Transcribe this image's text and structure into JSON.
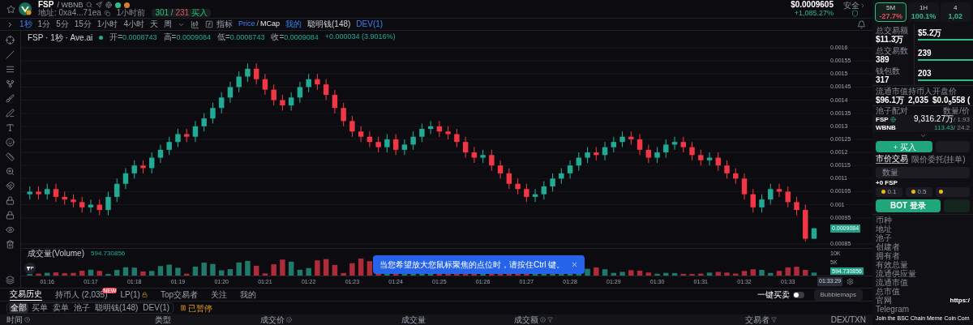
{
  "header": {
    "symbol": "FSP",
    "pair": "/ WBNB",
    "address": "地址: 0xa4...71ea",
    "age": "1小时前",
    "tx_counts": {
      "buys": "301",
      "separator": "/",
      "sells": "231",
      "label": "买入"
    },
    "price": "$0.0009605",
    "change": "+1,085.27%",
    "safety": "安全"
  },
  "toolbar": {
    "intervals": [
      {
        "label": "1秒",
        "selected": true
      },
      {
        "label": "1分",
        "selected": false
      },
      {
        "label": "5分",
        "selected": false
      },
      {
        "label": "15分",
        "selected": false
      },
      {
        "label": "1小时",
        "selected": false
      },
      {
        "label": "4小时",
        "selected": false
      },
      {
        "label": "天",
        "selected": false
      },
      {
        "label": "周",
        "selected": false
      }
    ],
    "indicators": "指标",
    "price_mcap": [
      {
        "label": "Price",
        "selected": true
      },
      {
        "label": "MCap",
        "selected": false
      }
    ],
    "price_mcap_separator": "/",
    "markers": [
      {
        "label": "我的",
        "on": true
      },
      {
        "label": "聪明钱(148)",
        "on": false
      },
      {
        "label": "DEV(1)",
        "on": true
      }
    ]
  },
  "legend": {
    "title": "FSP · 1秒 · Ave.ai",
    "ohlc": [
      {
        "label": "开=",
        "value": "0.0008743"
      },
      {
        "label": "高=",
        "value": "0.0009084"
      },
      {
        "label": "低=",
        "value": "0.0008743"
      },
      {
        "label": "收=",
        "value": "0.0009084"
      }
    ],
    "change": "+0.000034 (3.9016%)"
  },
  "price_chart": {
    "chart_data": {
      "type": "candlestick",
      "grid": true,
      "xlim": [
        75.4,
        94.94
      ],
      "ylim": [
        0.00085,
        0.0016
      ],
      "x": [
        75.6,
        75.8,
        76,
        76.2,
        76.4,
        76.6,
        76.8,
        77,
        77.2,
        77.4,
        77.6,
        77.8,
        78,
        78.2,
        78.4,
        78.6,
        78.8,
        79,
        79.2,
        79.4,
        79.6,
        79.8,
        80,
        80.2,
        80.4,
        80.6,
        80.8,
        81,
        81.2,
        81.4,
        81.6,
        81.8,
        82,
        82.2,
        82.4,
        82.6,
        82.8,
        83,
        83.2,
        83.4,
        83.6,
        83.8,
        84,
        84.2,
        84.4,
        84.6,
        84.8,
        85,
        85.2,
        85.4,
        85.6,
        85.8,
        86,
        86.2,
        86.4,
        86.6,
        86.8,
        87,
        87.2,
        87.4,
        87.6,
        87.8,
        88,
        88.2,
        88.4,
        88.6,
        88.8,
        89,
        89.2,
        89.4,
        89.6,
        89.8,
        90,
        90.2,
        90.4,
        90.6,
        90.8,
        91,
        91.2,
        91.4,
        91.6,
        91.8,
        92,
        92.2,
        92.4,
        92.6,
        92.8,
        93,
        93.2,
        93.4,
        93.6
      ],
      "ohlc": [
        [
          0.00104,
          0.00107,
          0.00102,
          0.00105
        ],
        [
          0.00105,
          0.00107,
          0.00102,
          0.00104
        ],
        [
          0.00104,
          0.00108,
          0.00102,
          0.00106
        ],
        [
          0.00106,
          0.00108,
          0.00101,
          0.00103
        ],
        [
          0.00103,
          0.00105,
          0.001,
          0.00102
        ],
        [
          0.00102,
          0.00104,
          0.00099,
          0.00101
        ],
        [
          0.00101,
          0.00103,
          0.00097,
          0.00099
        ],
        [
          0.00099,
          0.00102,
          0.00097,
          0.001
        ],
        [
          0.001,
          0.00102,
          0.00096,
          0.00098
        ],
        [
          0.00098,
          0.00105,
          0.00096,
          0.00103
        ],
        [
          0.00103,
          0.0011,
          0.00101,
          0.00108
        ],
        [
          0.00108,
          0.00114,
          0.00106,
          0.00112
        ],
        [
          0.00112,
          0.00117,
          0.0011,
          0.00115
        ],
        [
          0.00115,
          0.00117,
          0.00112,
          0.00114
        ],
        [
          0.00114,
          0.0012,
          0.00112,
          0.00118
        ],
        [
          0.00118,
          0.00123,
          0.00116,
          0.00121
        ],
        [
          0.00121,
          0.00126,
          0.00119,
          0.00124
        ],
        [
          0.00124,
          0.00129,
          0.00122,
          0.00127
        ],
        [
          0.00127,
          0.00129,
          0.00124,
          0.00126
        ],
        [
          0.00126,
          0.00132,
          0.00124,
          0.0013
        ],
        [
          0.0013,
          0.00135,
          0.00128,
          0.00133
        ],
        [
          0.00133,
          0.00139,
          0.00131,
          0.00137
        ],
        [
          0.00137,
          0.00143,
          0.00135,
          0.00141
        ],
        [
          0.00141,
          0.00147,
          0.00139,
          0.00145
        ],
        [
          0.00145,
          0.00151,
          0.00143,
          0.00149
        ],
        [
          0.00149,
          0.00154,
          0.00147,
          0.00152
        ],
        [
          0.00152,
          0.00154,
          0.00146,
          0.00148
        ],
        [
          0.00148,
          0.0015,
          0.00142,
          0.00144
        ],
        [
          0.00144,
          0.00146,
          0.00138,
          0.0014
        ],
        [
          0.0014,
          0.00142,
          0.00136,
          0.00138
        ],
        [
          0.00138,
          0.00143,
          0.00136,
          0.00141
        ],
        [
          0.00141,
          0.00147,
          0.00139,
          0.00145
        ],
        [
          0.00145,
          0.0015,
          0.00143,
          0.00148
        ],
        [
          0.00148,
          0.0015,
          0.00144,
          0.00146
        ],
        [
          0.00146,
          0.00148,
          0.0014,
          0.00142
        ],
        [
          0.00142,
          0.00144,
          0.00135,
          0.00137
        ],
        [
          0.00137,
          0.00139,
          0.0013,
          0.00132
        ],
        [
          0.00132,
          0.00134,
          0.00126,
          0.00128
        ],
        [
          0.00128,
          0.0013,
          0.00124,
          0.00126
        ],
        [
          0.00126,
          0.00128,
          0.00122,
          0.00124
        ],
        [
          0.00124,
          0.00126,
          0.0012,
          0.00122
        ],
        [
          0.00122,
          0.00127,
          0.0012,
          0.00125
        ],
        [
          0.00125,
          0.00127,
          0.00119,
          0.00121
        ],
        [
          0.00121,
          0.00125,
          0.00119,
          0.00123
        ],
        [
          0.00123,
          0.00128,
          0.00121,
          0.00126
        ],
        [
          0.00126,
          0.00131,
          0.00124,
          0.00129
        ],
        [
          0.00129,
          0.00132,
          0.00127,
          0.0013
        ],
        [
          0.0013,
          0.00132,
          0.00126,
          0.00128
        ],
        [
          0.00128,
          0.0013,
          0.00125,
          0.00127
        ],
        [
          0.00127,
          0.00129,
          0.00122,
          0.00124
        ],
        [
          0.00124,
          0.00126,
          0.00118,
          0.0012
        ],
        [
          0.0012,
          0.00122,
          0.00116,
          0.00118
        ],
        [
          0.00118,
          0.00121,
          0.00116,
          0.00119
        ],
        [
          0.00119,
          0.00121,
          0.00113,
          0.00115
        ],
        [
          0.00115,
          0.00117,
          0.0011,
          0.00112
        ],
        [
          0.00112,
          0.00114,
          0.00106,
          0.00108
        ],
        [
          0.00108,
          0.0011,
          0.00104,
          0.00106
        ],
        [
          0.00106,
          0.00108,
          0.00101,
          0.00103
        ],
        [
          0.00103,
          0.00106,
          0.00101,
          0.00104
        ],
        [
          0.00104,
          0.00109,
          0.00102,
          0.00107
        ],
        [
          0.00107,
          0.00112,
          0.00105,
          0.0011
        ],
        [
          0.0011,
          0.00114,
          0.00108,
          0.00112
        ],
        [
          0.00112,
          0.00117,
          0.0011,
          0.00115
        ],
        [
          0.00115,
          0.0012,
          0.00113,
          0.00118
        ],
        [
          0.00118,
          0.00122,
          0.00116,
          0.0012
        ],
        [
          0.0012,
          0.00122,
          0.00117,
          0.00119
        ],
        [
          0.00119,
          0.00124,
          0.00117,
          0.00122
        ],
        [
          0.00122,
          0.00126,
          0.0012,
          0.00124
        ],
        [
          0.00124,
          0.00128,
          0.00122,
          0.00126
        ],
        [
          0.00126,
          0.00128,
          0.00123,
          0.00125
        ],
        [
          0.00125,
          0.00127,
          0.00119,
          0.00121
        ],
        [
          0.00121,
          0.00123,
          0.00116,
          0.00118
        ],
        [
          0.00118,
          0.00122,
          0.00116,
          0.0012
        ],
        [
          0.0012,
          0.00125,
          0.00118,
          0.00123
        ],
        [
          0.00123,
          0.00126,
          0.00121,
          0.00124
        ],
        [
          0.00124,
          0.00126,
          0.0012,
          0.00122
        ],
        [
          0.00122,
          0.00124,
          0.00117,
          0.00119
        ],
        [
          0.00119,
          0.00121,
          0.00115,
          0.00117
        ],
        [
          0.00117,
          0.0012,
          0.00115,
          0.00118
        ],
        [
          0.00118,
          0.0012,
          0.00113,
          0.00115
        ],
        [
          0.00115,
          0.00117,
          0.0011,
          0.00112
        ],
        [
          0.00112,
          0.00114,
          0.00108,
          0.0011
        ],
        [
          0.0011,
          0.00112,
          0.00102,
          0.00104
        ],
        [
          0.00104,
          0.00106,
          0.00097,
          0.00099
        ],
        [
          0.00099,
          0.00104,
          0.00097,
          0.00102
        ],
        [
          0.00102,
          0.00108,
          0.001,
          0.00106
        ],
        [
          0.00106,
          0.00108,
          0.00103,
          0.00105
        ],
        [
          0.00105,
          0.00107,
          0.00099,
          0.00101
        ],
        [
          0.00101,
          0.00103,
          0.00096,
          0.00098
        ],
        [
          0.00098,
          0.001,
          0.00086,
          0.00087
        ],
        [
          0.00087,
          0.00091,
          0.00087,
          0.00091
        ]
      ],
      "yticks": [
        {
          "value": 0.0016,
          "label": "0.0016"
        },
        {
          "value": 0.00155,
          "label": "0.00155"
        },
        {
          "value": 0.0015,
          "label": "0.0015"
        },
        {
          "value": 0.00145,
          "label": "0.00145"
        },
        {
          "value": 0.0014,
          "label": "0.0014"
        },
        {
          "value": 0.00135,
          "label": "0.00135"
        },
        {
          "value": 0.0013,
          "label": "0.0013"
        },
        {
          "value": 0.00125,
          "label": "0.00125"
        },
        {
          "value": 0.0012,
          "label": "0.0012"
        },
        {
          "value": 0.00115,
          "label": "0.00115"
        },
        {
          "value": 0.0011,
          "label": "0.0011"
        },
        {
          "value": 0.00105,
          "label": "0.00105"
        },
        {
          "value": 0.001,
          "label": "0.001"
        },
        {
          "value": 0.00095,
          "label": "0.00095"
        },
        {
          "value": 0.00085,
          "label": "0.00085"
        }
      ],
      "xticks": [
        {
          "value": 76,
          "label": "01:16"
        },
        {
          "value": 77,
          "label": "01:17"
        },
        {
          "value": 78,
          "label": "01:18"
        },
        {
          "value": 79,
          "label": "01:19"
        },
        {
          "value": 80,
          "label": "01:20"
        },
        {
          "value": 81,
          "label": "01:21"
        },
        {
          "value": 82,
          "label": "01:22"
        },
        {
          "value": 83,
          "label": "01:23"
        },
        {
          "value": 84,
          "label": "01:24"
        },
        {
          "value": 85,
          "label": "01:25"
        },
        {
          "value": 86,
          "label": "01:26"
        },
        {
          "value": 87,
          "label": "01:27"
        },
        {
          "value": 88,
          "label": "01:28"
        },
        {
          "value": 89,
          "label": "01:29"
        },
        {
          "value": 90,
          "label": "01:30"
        },
        {
          "value": 91,
          "label": "01:31"
        },
        {
          "value": 92,
          "label": "01:32"
        },
        {
          "value": 93,
          "label": "01:33"
        }
      ]
    },
    "current_price": "0.0009084",
    "time_tag": "01:33:29"
  },
  "volume": {
    "label": "成交量(Volume)",
    "value": "594.730856",
    "axis": [
      "10K",
      "5K"
    ],
    "tag": "594.730856"
  },
  "toast": "当您希望放大您鼠标聚焦的点位时，请按住Ctrl 键。",
  "bottom_tabs": [
    {
      "label": "交易历史",
      "selected": true
    },
    {
      "label": "持币人 (2,035)",
      "selected": false,
      "badge": "NEW"
    },
    {
      "label": "LP(1)",
      "selected": false,
      "locked": true
    },
    {
      "label": "Top交易者",
      "selected": false
    },
    {
      "label": "关注",
      "selected": false
    },
    {
      "label": "我的",
      "selected": false
    }
  ],
  "one_click": {
    "label": "一键买卖",
    "on": false
  },
  "bubblemaps": "Bubblemaps",
  "filters": [
    {
      "label": "全部",
      "selected": true
    },
    {
      "label": "买单",
      "selected": false
    },
    {
      "label": "卖单",
      "selected": false
    },
    {
      "label": "池子",
      "selected": false
    },
    {
      "label": "聪明钱(148)",
      "selected": false
    },
    {
      "label": "DEV(1)",
      "selected": false
    }
  ],
  "paused": "已暂停",
  "table": {
    "columns": [
      "时间",
      "类型",
      "成交价",
      "成交量",
      "成交额",
      "交易者",
      "DEX/TXN"
    ]
  },
  "side_panel": {
    "timeframes": [
      {
        "label": "5M",
        "change": "-27.7%",
        "selected": true,
        "color": "#f6465d"
      },
      {
        "label": "1H",
        "change": "100.1%",
        "selected": false,
        "color": "#2ebd85"
      },
      {
        "label": "4",
        "change": "1,02",
        "selected": false,
        "color": "#2ebd85"
      }
    ],
    "stats": [
      {
        "label": "总交易额",
        "value": "$11.3万",
        "buy": "$5.2万"
      },
      {
        "label": "总交易数",
        "value": "389",
        "buy": "239"
      },
      {
        "label": "钱包数",
        "value": "317",
        "buy": "203"
      }
    ],
    "market": [
      {
        "label": "流通市值",
        "value": "$96.1万"
      },
      {
        "label": "持币人",
        "value": "2,035"
      },
      {
        "label": "开盘价",
        "value": "$0.0$_{5}$558 ("
      }
    ],
    "pool": {
      "label": "池子配对",
      "amount_label": "数量/价",
      "rows": [
        {
          "token": "FSP",
          "amount": "9,316.27万",
          "price": "/ 1.93"
        },
        {
          "token": "WBNB",
          "amount": "113.43",
          "price": "/ 24.2"
        }
      ]
    },
    "trade_side": [
      {
        "label": "买入",
        "selected": true
      },
      {
        "selected": false
      }
    ],
    "order_types": [
      {
        "label": "市价交易",
        "selected": true
      },
      {
        "label": "限价委托(挂单)",
        "selected": false
      }
    ],
    "amount_placeholder": "数量",
    "receive": "+0 FSP",
    "amounts": [
      "0.1",
      "0.5"
    ],
    "login": "BOT 登录",
    "info": [
      {
        "label": "币种"
      },
      {
        "label": "地址"
      },
      {
        "label": "池子"
      },
      {
        "label": "创建者"
      },
      {
        "label": "拥有者"
      },
      {
        "label": "有效总量"
      },
      {
        "label": "流通供应量"
      },
      {
        "label": "流通市值"
      },
      {
        "label": "总市值"
      },
      {
        "label": "官网",
        "value": "https:/"
      },
      {
        "label": "Telegram"
      }
    ],
    "description": "Join the BSC Chain Meme Coin Com"
  }
}
